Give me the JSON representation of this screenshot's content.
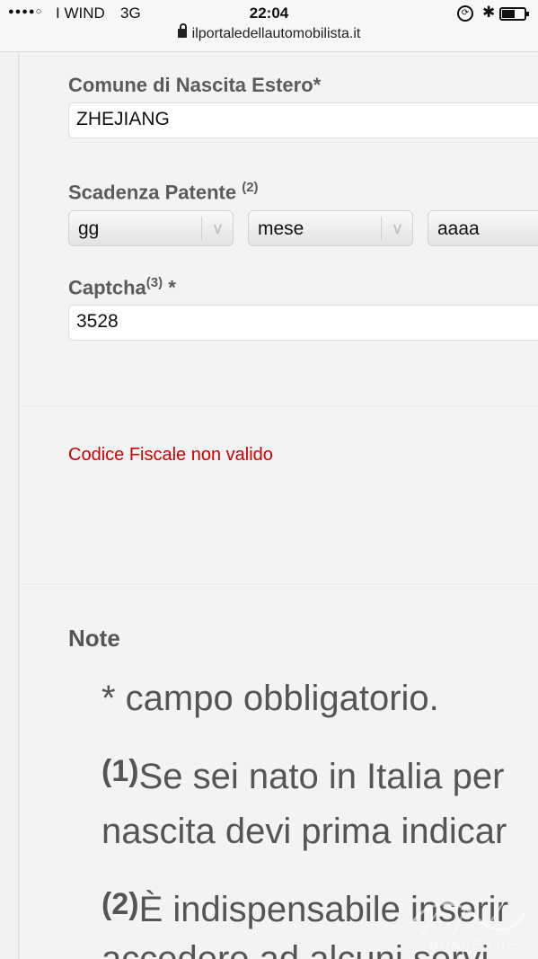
{
  "status_bar": {
    "signal": "●●●●○",
    "carrier": "I WIND",
    "network": "3G",
    "time": "22:04",
    "url": "ilportaledellautomobilista.it"
  },
  "form": {
    "birth_abroad_label": "Comune di Nascita Estero*",
    "birth_abroad_value": "ZHEJIANG",
    "license_expiry_label": "Scadenza Patente",
    "license_expiry_note": "(2)",
    "day_select": "gg",
    "month_select": "mese",
    "year_select": "aaaa",
    "captcha_label": "Captcha",
    "captcha_note": "(3)",
    "captcha_star": "*",
    "captcha_value": "3528"
  },
  "error_message": "Codice Fiscale non valido",
  "notes": {
    "title": "Note",
    "required": "* campo obbligatorio.",
    "note1_num": "(1)",
    "note1_line1": "Se sei nato in Italia per",
    "note1_line2": "nascita devi prima indicar",
    "note2_num": "(2)",
    "note2_line1": "È indispensabile inserir",
    "note2_line2": "accedere ad alcuni servi"
  },
  "watermark": "HUARENJIE"
}
